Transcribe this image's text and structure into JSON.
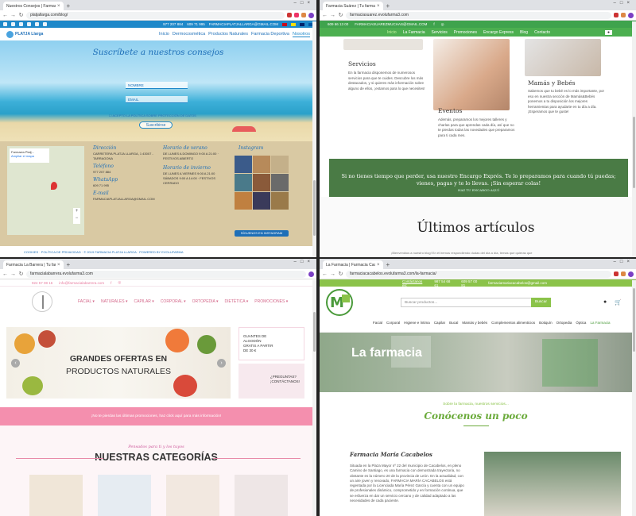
{
  "q1": {
    "tab_title": "Nuestros Consejos | Farmacia Pl...",
    "url": "platjallarga.com/blog/",
    "topbar": {
      "phone1": "977 207 884",
      "phone2": "609 71 995",
      "email": "FARMACIAPLATJALLARGA@GMAIL.COM"
    },
    "logo": "PLATJA Llarga",
    "nav": [
      "Inicio",
      "Dermocosmética",
      "Productos Naturales",
      "Farmacia Deportiva",
      "Nosotros"
    ],
    "hero_title": "Suscríbete a nuestros consejos",
    "name_placeholder": "NOMBRE",
    "email_placeholder": "EMAIL",
    "accept_text": "ACEPTO LA POLÍTICA SOBRE PROTECCIÓN DE DATOS",
    "subscribe_button": "Suscribirse",
    "map_card_title": "Farmacia Platj...",
    "map_card_link": "Ampliar el mapa",
    "direccion_h": "Dirección",
    "direccion_v": "CARRETERA PLATJA LLARGA, 1 43007 - TARRAGONA",
    "telefono_h": "Teléfono",
    "telefono_v": "977 207 884",
    "whatsapp_h": "WhatsApp",
    "whatsapp_v": "609 71 995",
    "email_h": "E-mail",
    "email_v": "FARMACIAPLATJALLARGA@GMAIL.COM",
    "verano_h": "Horario de verano",
    "verano_v": "DE LUNES A DOMINGO 9:00 A 21:00 · FESTIVOS ABIERTO",
    "invierno_h": "Horario de invierno",
    "invierno_v": "DE LUNES A VIERNES 9:00 A 21:00 SÁBADOS 9:00 A 14:00 · FESTIVOS CERRADO",
    "instagram_h": "Instagram",
    "instagram_button": "SÍGUENOS EN INSTAGRAM",
    "bottom": "COOKIES · POLÍTICA DE PRIVACIDAD · © 2019 FARMACIA PLATJA LLARGA · POWERED BY EVOLUFARMA"
  },
  "q2": {
    "tab_title": "Farmacia Suárez | Tu farmacia o...",
    "url": "farmaciasuarez.evolufarma3.com",
    "topbar": {
      "phone": "609 66 13 00",
      "email": "FARMACIASUAREZMUCHAS@GMAIL.COM"
    },
    "nav": [
      "Inicio",
      "La Farmacia",
      "Servicios",
      "Promociones",
      "Encargo Express",
      "Blog",
      "Contacto"
    ],
    "servicios_h": "Servicios",
    "servicios_p": "En la farmacia disponemos de numerosos servicios para que te cuides. Descubre los más destacados, y si quieres más información sobre alguno de ellos, ¡estamos para lo que necesites!",
    "eventos_h": "Eventos",
    "eventos_p": "Además, preparamos los mejores talleres y charlas para que aprendas cada día, así que no te pierdas todas las novedades que preparamos para ti cada mes.",
    "mamas_h": "Mamás y Bebés",
    "mamas_p": "Sabemos que tu bebé es lo más importante, por eso en nuestra sección de Mamás&Bebés ponemos a tu disposición los mejores herramientas para ayudarte en tu día a día. ¡Esperamos que te guste!",
    "banner": "Si no tienes tiempo que perder, usa nuestro Encargo Exprés. Te lo preparamos para cuando tú puedas; vienes, pagas y te lo llevas. ¡Sin esperar colas!",
    "banner_small": "HAZ TU ENCARGO AQUÍ",
    "ultimos": "Últimos artículos",
    "footer_text": "¡Bienvenidos a nuestro blog! En él iremos respondiendo dudas del día a día, temas que quieras que"
  },
  "q3": {
    "tab_title": "Farmacia La Barrera | Tu farmacia",
    "url": "farmacialabarrera.evolufarma3.com",
    "topbar": {
      "phone": "924 57 08 16",
      "email": "info@farmacialabarrera.com"
    },
    "nav": [
      "FACIAL",
      "NATURALES",
      "CAPILAR",
      "CORPORAL",
      "ORTOPEDIA",
      "DIETÉTICA",
      "PROMOCIONES"
    ],
    "hero_line1": "GRANDES OFERTAS EN",
    "hero_line2": "PRODUCTOS NATURALES",
    "side1_text": "GUANTES DE ALGODÓN GRATIS A PARTIR DE 30 €",
    "side2_text": "¿PREGUNTAS? ¡CONTÁCTANOS!",
    "pink_bar": "¡No te pierdas las últimas promociones, haz click aquí para más información!",
    "cat_small": "Pensados para ti y los tuyos",
    "cat_title": "NUESTRAS CATEGORÍAS"
  },
  "q4": {
    "tab_title": "La Farmacia | Farmacia Cacabe...",
    "url": "farmaciacacabelos.evolufarma3.com/la-farmacia/",
    "topbar": {
      "label": "Contáctanos en:",
      "phone1": "987 54 68 61",
      "phone2": "609 57 00 81",
      "email": "farmaciamariacacabelos@gmail.com"
    },
    "search_placeholder": "Buscar productos...",
    "search_button": "Buscar",
    "menu": [
      "Facial",
      "Corporal",
      "Higiene e íntima",
      "Capilar",
      "Bucal",
      "Mamás y bebés",
      "Complementos alimenticios",
      "Botiquín",
      "Ortopedia",
      "Óptica",
      "La Farmacia"
    ],
    "hero_title": "La farmacia",
    "sub": "Sobre la farmacia, nuestros servicios...",
    "title": "Conócenos un poco",
    "h3": "Farmacia María Cacabelos",
    "p": "Situada en la Plaza Mayor nº 22 del municipio de Cacabelos, en pleno Camino de Santiago, es una farmacia con demostrada trayectoria, no obstante es la número 20 de la provincia de León. En la actualidad, con un aire joven y renovado, FARMACIA MARÍA CACABELOS está regentada por la Licenciada María Pérez García y cuenta con un equipo de profesionales dinámico, comprometido y en formación continua, que se esfuerza en dar un servicio cercano y de calidad adaptado a las necesidades de cada paciente."
  },
  "colors": {
    "q1_blue": "#1e88c9",
    "q2_green": "#4caf50",
    "q3_pink": "#f48fae",
    "q4_green": "#8bc34a"
  }
}
